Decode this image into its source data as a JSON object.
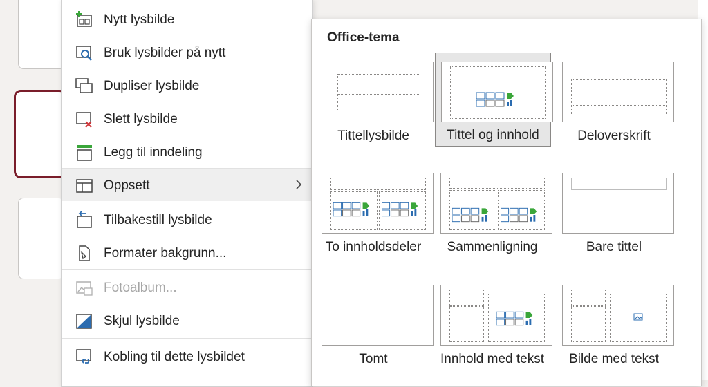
{
  "menu": {
    "items": [
      {
        "label": "Nytt lysbilde",
        "icon": "new-slide-icon"
      },
      {
        "label": "Bruk lysbilder på nytt",
        "icon": "reuse-slides-icon"
      },
      {
        "label": "Dupliser lysbilde",
        "icon": "duplicate-slide-icon"
      },
      {
        "label": "Slett lysbilde",
        "icon": "delete-slide-icon"
      },
      {
        "label": "Legg til inndeling",
        "icon": "add-section-icon"
      },
      {
        "label": "Oppsett",
        "icon": "layout-icon",
        "state": "hover",
        "submenu": true
      },
      {
        "label": "Tilbakestill lysbilde",
        "icon": "reset-slide-icon"
      },
      {
        "label": "Formater bakgrunn...",
        "icon": "format-background-icon"
      },
      {
        "label": "Fotoalbum...",
        "icon": "photo-album-icon",
        "state": "disabled"
      },
      {
        "label": "Skjul lysbilde",
        "icon": "hide-slide-icon"
      },
      {
        "label": "Kobling til dette lysbildet",
        "icon": "link-slide-icon"
      }
    ]
  },
  "submenu": {
    "title": "Office-tema",
    "layouts": [
      {
        "label": "Tittellysbilde"
      },
      {
        "label": "Tittel og innhold",
        "selected": true
      },
      {
        "label": "Deloverskrift"
      },
      {
        "label": "To innholdsdeler"
      },
      {
        "label": "Sammenligning"
      },
      {
        "label": "Bare tittel"
      },
      {
        "label": "Tomt"
      },
      {
        "label": "Innhold med tekst"
      },
      {
        "label": "Bilde med tekst"
      }
    ]
  },
  "colors": {
    "selected_slide_border": "#7a1d2a",
    "menu_hover": "#efefef",
    "icon_green": "#3aa63a",
    "icon_red": "#d13438",
    "icon_blue": "#2b6cb0"
  }
}
